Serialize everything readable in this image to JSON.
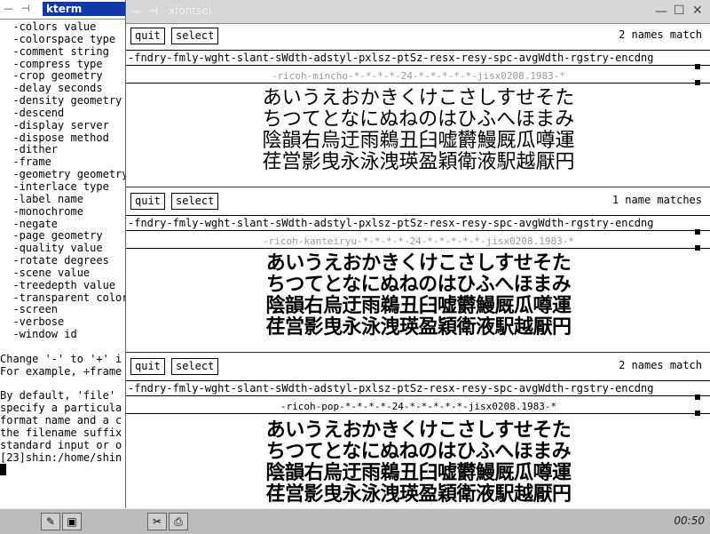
{
  "kterm": {
    "title": "kterm",
    "lines": [
      "  -colors value",
      "  -colorspace type",
      "  -comment string",
      "  -compress type",
      "  -crop geometry",
      "  -delay seconds",
      "  -density geometry",
      "  -descend",
      "  -display server",
      "  -dispose method",
      "  -dither",
      "  -frame",
      "  -geometry geometry",
      "  -interlace type",
      "  -label name",
      "  -monochrome",
      "  -negate",
      "  -page geometry",
      "  -quality value",
      "  -rotate degrees",
      "  -scene value",
      "  -treedepth value",
      "  -transparent color",
      "  -screen",
      "  -verbose",
      "  -window id",
      "",
      "Change '-' to '+' i",
      "For example, +frame",
      "",
      "By default, 'file'",
      "specify a particula",
      "format name and a c",
      "the filename suffix",
      "standard input or o",
      "[23]shin:/home/shin"
    ]
  },
  "xfontsel": {
    "title": "xfontsel",
    "field_header": "-fndry-fmly-wght-slant-sWdth-adstyl-pxlsz-ptSz-resx-resy-spc-avgWdth-rgstry-encdng",
    "quit_label": "quit",
    "select_label": "select",
    "sample_lines": [
      "あいうえおかきくけこさしすせそた",
      "ちつてとなにぬねのはひふへほまみ",
      "陰韻右烏迂雨鵜丑臼嘘欝鰻厩瓜噂運",
      "荏営影曳永泳洩瑛盈穎衛液駅越厭円"
    ],
    "panes": [
      {
        "match_text": "2 names match",
        "pattern": "-ricoh-mincho-*-*-*-*-24-*-*-*-*-*-jisx0208.1983-*"
      },
      {
        "match_text": "1 name matches",
        "pattern": "-ricoh-kanteiryu-*-*-*-*-24-*-*-*-*-*-jisx0208.1983-*"
      },
      {
        "match_text": "2 names match",
        "pattern": "-ricoh-pop-*-*-*-*-24-*-*-*-*-*-jisx0208.1983-*"
      }
    ]
  },
  "taskbar": {
    "clock": "00:50"
  }
}
